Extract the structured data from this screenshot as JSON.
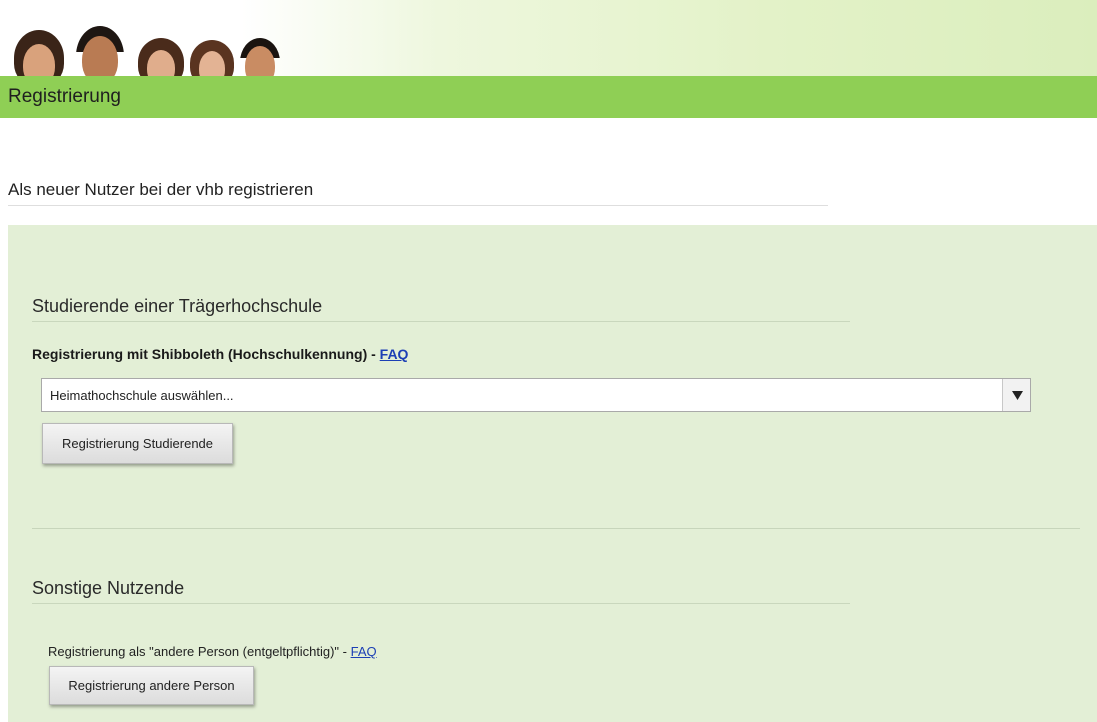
{
  "header": {
    "title": "Registrierung"
  },
  "intro": {
    "heading": "Als neuer Nutzer bei der vhb registrieren"
  },
  "students_section": {
    "title": "Studierende einer Trägerhochschule",
    "shibboleth_label": "Registrierung mit Shibboleth (Hochschulkennung) - ",
    "faq_link": "FAQ",
    "university_select": {
      "selected": "Heimathochschule auswählen..."
    },
    "register_button": "Registrierung Studierende"
  },
  "others_section": {
    "title": "Sonstige Nutzende",
    "label": "Registrierung als \"andere Person (entgeltpflichtig)\" - ",
    "faq_link": "FAQ",
    "register_button": "Registrierung andere Person"
  },
  "colors": {
    "title_bar": "#8fcf55",
    "panel_background": "#e3efd6",
    "link": "#1c3fb5"
  },
  "icons": [
    "banner-faces-image",
    "dropdown-arrow-icon"
  ]
}
